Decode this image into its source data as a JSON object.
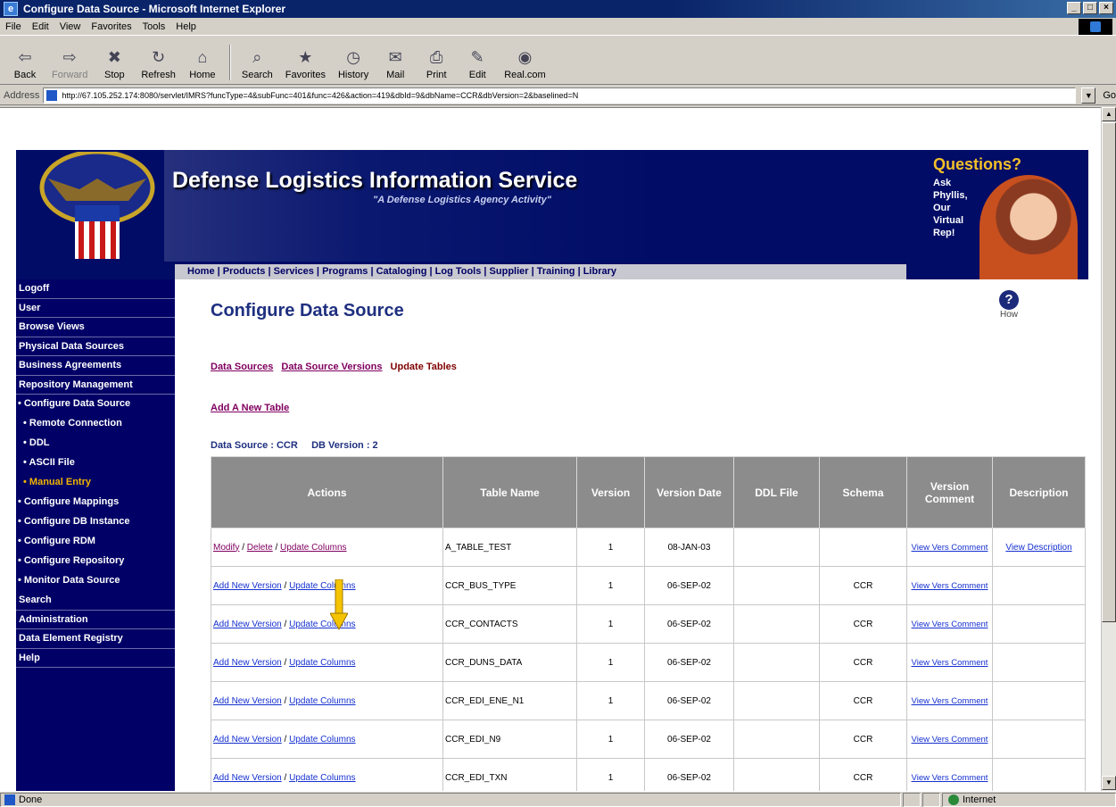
{
  "window": {
    "title": "Configure Data Source - Microsoft Internet Explorer",
    "buttons": [
      "_",
      "□",
      "×"
    ]
  },
  "menu": [
    "File",
    "Edit",
    "View",
    "Favorites",
    "Tools",
    "Help"
  ],
  "toolbar": [
    {
      "label": "Back",
      "icon": "back-arrow-icon",
      "glyph": "⇦"
    },
    {
      "label": "Forward",
      "icon": "forward-arrow-icon",
      "glyph": "⇨"
    },
    {
      "label": "Stop",
      "icon": "stop-icon",
      "glyph": "✖"
    },
    {
      "label": "Refresh",
      "icon": "refresh-icon",
      "glyph": "↻"
    },
    {
      "label": "Home",
      "icon": "home-icon",
      "glyph": "⌂"
    },
    {
      "label": "Search",
      "icon": "search-icon",
      "glyph": "⌕"
    },
    {
      "label": "Favorites",
      "icon": "favorites-icon",
      "glyph": "★"
    },
    {
      "label": "History",
      "icon": "history-icon",
      "glyph": "◷"
    },
    {
      "label": "Mail",
      "icon": "mail-icon",
      "glyph": "✉"
    },
    {
      "label": "Print",
      "icon": "print-icon",
      "glyph": "⎙"
    },
    {
      "label": "Edit",
      "icon": "edit-icon",
      "glyph": "✎"
    },
    {
      "label": "Real.com",
      "icon": "realcom-icon",
      "glyph": "◉"
    }
  ],
  "address": {
    "label": "Address",
    "url": "http://67.105.252.174:8080/servlet/IMRS?funcType=4&subFunc=401&func=426&action=419&dbId=9&dbName=CCR&dbVersion=2&baselined=N",
    "go": "Go"
  },
  "banner": {
    "title": "Defense Logistics Information Service",
    "tagline": "\"A Defense Logistics Agency Activity\"",
    "nav": "Home | Products | Services | Programs | Cataloging | Log Tools | Supplier | Training | Library",
    "questions_title": "Questions?",
    "questions_text": [
      "Ask",
      "Phyllis,",
      "Our",
      "Virtual",
      "Rep!"
    ]
  },
  "leftnav": [
    {
      "label": "Logoff",
      "level": 0
    },
    {
      "label": "User",
      "level": 0
    },
    {
      "label": "Browse Views",
      "level": 0
    },
    {
      "label": "Physical Data Sources",
      "level": 0
    },
    {
      "label": "Business Agreements",
      "level": 0
    },
    {
      "label": "Repository Management",
      "level": 0
    },
    {
      "label": "• Configure Data Source",
      "level": 1
    },
    {
      "label": "• Remote Connection",
      "level": 2
    },
    {
      "label": "• DDL",
      "level": 2
    },
    {
      "label": "• ASCII File",
      "level": 2
    },
    {
      "label": "• Manual Entry",
      "level": 2,
      "active": true
    },
    {
      "label": "• Configure Mappings",
      "level": 1
    },
    {
      "label": "• Configure DB Instance",
      "level": 1
    },
    {
      "label": "• Configure RDM",
      "level": 1
    },
    {
      "label": "• Configure Repository",
      "level": 1
    },
    {
      "label": "• Monitor Data Source",
      "level": 1
    },
    {
      "label": "Search",
      "level": 0
    },
    {
      "label": "Administration",
      "level": 0
    },
    {
      "label": "Data Element Registry",
      "level": 0
    },
    {
      "label": "Help",
      "level": 0
    }
  ],
  "main": {
    "title": "Configure Data Source",
    "help_label": "How",
    "help_glyph": "?",
    "crumbs": [
      "Data Sources",
      "Data Source Versions"
    ],
    "crumb_current": "Update Tables",
    "add_link": "Add A New Table",
    "data_source_label": "Data Source : CCR",
    "db_version_label": "DB Version : 2"
  },
  "table": {
    "headers": [
      "Actions",
      "Table Name",
      "Version",
      "Version Date",
      "DDL File",
      "Schema",
      "Version Comment",
      "Description"
    ],
    "rows": [
      {
        "actions": [
          "Modify",
          "Delete",
          "Update Columns"
        ],
        "name": "A_TABLE_TEST",
        "version": "1",
        "date": "08-JAN-03",
        "ddl": "",
        "schema": "",
        "comment": "View Vers Comment",
        "description": "View Description"
      },
      {
        "actions": [
          "Add New Version",
          "Update Columns"
        ],
        "name": "CCR_BUS_TYPE",
        "version": "1",
        "date": "06-SEP-02",
        "ddl": "",
        "schema": "CCR",
        "comment": "View Vers Comment",
        "description": ""
      },
      {
        "actions": [
          "Add New Version",
          "Update Columns"
        ],
        "name": "CCR_CONTACTS",
        "version": "1",
        "date": "06-SEP-02",
        "ddl": "",
        "schema": "CCR",
        "comment": "View Vers Comment",
        "description": ""
      },
      {
        "actions": [
          "Add New Version",
          "Update Columns"
        ],
        "name": "CCR_DUNS_DATA",
        "version": "1",
        "date": "06-SEP-02",
        "ddl": "",
        "schema": "CCR",
        "comment": "View Vers Comment",
        "description": ""
      },
      {
        "actions": [
          "Add New Version",
          "Update Columns"
        ],
        "name": "CCR_EDI_ENE_N1",
        "version": "1",
        "date": "06-SEP-02",
        "ddl": "",
        "schema": "CCR",
        "comment": "View Vers Comment",
        "description": ""
      },
      {
        "actions": [
          "Add New Version",
          "Update Columns"
        ],
        "name": "CCR_EDI_N9",
        "version": "1",
        "date": "06-SEP-02",
        "ddl": "",
        "schema": "CCR",
        "comment": "View Vers Comment",
        "description": ""
      },
      {
        "actions": [
          "Add New Version",
          "Update Columns"
        ],
        "name": "CCR_EDI_TXN",
        "version": "1",
        "date": "06-SEP-02",
        "ddl": "",
        "schema": "CCR",
        "comment": "View Vers Comment",
        "description": ""
      }
    ]
  },
  "status": {
    "text": "Done",
    "zone": "Internet"
  },
  "colors": {
    "title_bar": "#0a246a",
    "banner": "#000c66",
    "nav_active": "#f2b400",
    "table_header": "#8c8c8c",
    "link": "#1530d0",
    "visited": "#800060",
    "arrow": "#f5c400"
  }
}
